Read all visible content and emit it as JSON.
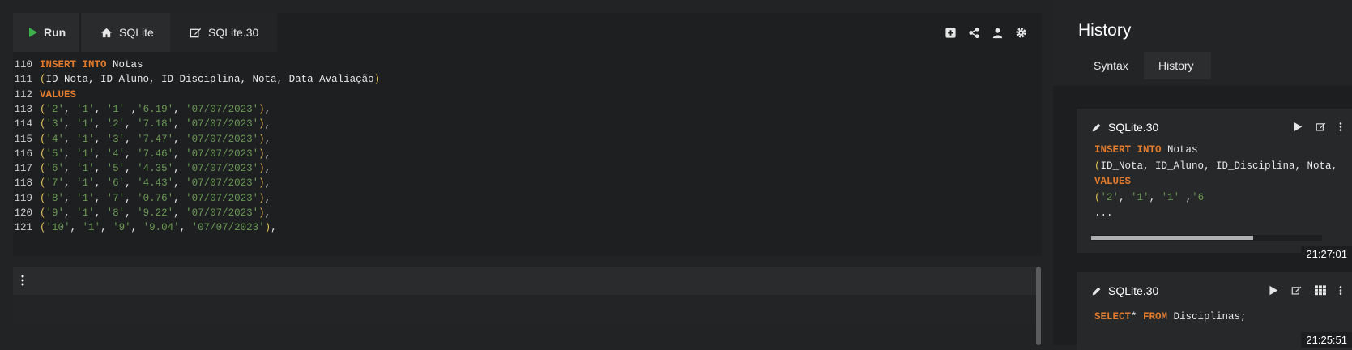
{
  "toolbar": {
    "run_label": "Run",
    "tabs": [
      {
        "label": "SQLite",
        "icon": "home-icon"
      },
      {
        "label": "SQLite.30",
        "icon": "edit-icon"
      }
    ],
    "icons": [
      "add-icon",
      "share-icon",
      "user-icon",
      "gear-icon"
    ]
  },
  "editor": {
    "lines": [
      {
        "n": "110",
        "tokens": [
          [
            "kw",
            "INSERT"
          ],
          [
            "code",
            " "
          ],
          [
            "kw",
            "INTO"
          ],
          [
            "code",
            " Notas"
          ]
        ]
      },
      {
        "n": "111",
        "tokens": [
          [
            "pun",
            "("
          ],
          [
            "code",
            "ID_Nota, ID_Aluno, ID_Disciplina, Nota, Data_Avaliação"
          ],
          [
            "pun",
            ")"
          ]
        ]
      },
      {
        "n": "112",
        "tokens": [
          [
            "kw",
            "VALUES"
          ]
        ]
      },
      {
        "n": "113",
        "tokens": [
          [
            "pun",
            "("
          ],
          [
            "str",
            "'2'"
          ],
          [
            "code",
            ", "
          ],
          [
            "str",
            "'1'"
          ],
          [
            "code",
            ", "
          ],
          [
            "str",
            "'1'"
          ],
          [
            "code",
            " ,"
          ],
          [
            "str",
            "'6.19'"
          ],
          [
            "code",
            ", "
          ],
          [
            "str",
            "'07/07/2023'"
          ],
          [
            "pun",
            ")"
          ],
          [
            "code",
            ","
          ]
        ]
      },
      {
        "n": "114",
        "tokens": [
          [
            "pun",
            "("
          ],
          [
            "str",
            "'3'"
          ],
          [
            "code",
            ", "
          ],
          [
            "str",
            "'1'"
          ],
          [
            "code",
            ", "
          ],
          [
            "str",
            "'2'"
          ],
          [
            "code",
            ", "
          ],
          [
            "str",
            "'7.18'"
          ],
          [
            "code",
            ", "
          ],
          [
            "str",
            "'07/07/2023'"
          ],
          [
            "pun",
            ")"
          ],
          [
            "code",
            ","
          ]
        ]
      },
      {
        "n": "115",
        "tokens": [
          [
            "pun",
            "("
          ],
          [
            "str",
            "'4'"
          ],
          [
            "code",
            ", "
          ],
          [
            "str",
            "'1'"
          ],
          [
            "code",
            ", "
          ],
          [
            "str",
            "'3'"
          ],
          [
            "code",
            ", "
          ],
          [
            "str",
            "'7.47'"
          ],
          [
            "code",
            ", "
          ],
          [
            "str",
            "'07/07/2023'"
          ],
          [
            "pun",
            ")"
          ],
          [
            "code",
            ","
          ]
        ]
      },
      {
        "n": "116",
        "tokens": [
          [
            "pun",
            "("
          ],
          [
            "str",
            "'5'"
          ],
          [
            "code",
            ", "
          ],
          [
            "str",
            "'1'"
          ],
          [
            "code",
            ", "
          ],
          [
            "str",
            "'4'"
          ],
          [
            "code",
            ", "
          ],
          [
            "str",
            "'7.46'"
          ],
          [
            "code",
            ", "
          ],
          [
            "str",
            "'07/07/2023'"
          ],
          [
            "pun",
            ")"
          ],
          [
            "code",
            ","
          ]
        ]
      },
      {
        "n": "117",
        "tokens": [
          [
            "pun",
            "("
          ],
          [
            "str",
            "'6'"
          ],
          [
            "code",
            ", "
          ],
          [
            "str",
            "'1'"
          ],
          [
            "code",
            ", "
          ],
          [
            "str",
            "'5'"
          ],
          [
            "code",
            ", "
          ],
          [
            "str",
            "'4.35'"
          ],
          [
            "code",
            ", "
          ],
          [
            "str",
            "'07/07/2023'"
          ],
          [
            "pun",
            ")"
          ],
          [
            "code",
            ","
          ]
        ]
      },
      {
        "n": "118",
        "tokens": [
          [
            "pun",
            "("
          ],
          [
            "str",
            "'7'"
          ],
          [
            "code",
            ", "
          ],
          [
            "str",
            "'1'"
          ],
          [
            "code",
            ", "
          ],
          [
            "str",
            "'6'"
          ],
          [
            "code",
            ", "
          ],
          [
            "str",
            "'4.43'"
          ],
          [
            "code",
            ", "
          ],
          [
            "str",
            "'07/07/2023'"
          ],
          [
            "pun",
            ")"
          ],
          [
            "code",
            ","
          ]
        ]
      },
      {
        "n": "119",
        "tokens": [
          [
            "pun",
            "("
          ],
          [
            "str",
            "'8'"
          ],
          [
            "code",
            ", "
          ],
          [
            "str",
            "'1'"
          ],
          [
            "code",
            ", "
          ],
          [
            "str",
            "'7'"
          ],
          [
            "code",
            ", "
          ],
          [
            "str",
            "'0.76'"
          ],
          [
            "code",
            ", "
          ],
          [
            "str",
            "'07/07/2023'"
          ],
          [
            "pun",
            ")"
          ],
          [
            "code",
            ","
          ]
        ]
      },
      {
        "n": "120",
        "tokens": [
          [
            "pun",
            "("
          ],
          [
            "str",
            "'9'"
          ],
          [
            "code",
            ", "
          ],
          [
            "str",
            "'1'"
          ],
          [
            "code",
            ", "
          ],
          [
            "str",
            "'8'"
          ],
          [
            "code",
            ", "
          ],
          [
            "str",
            "'9.22'"
          ],
          [
            "code",
            ", "
          ],
          [
            "str",
            "'07/07/2023'"
          ],
          [
            "pun",
            ")"
          ],
          [
            "code",
            ","
          ]
        ]
      },
      {
        "n": "121",
        "tokens": [
          [
            "pun",
            "("
          ],
          [
            "str",
            "'10'"
          ],
          [
            "code",
            ", "
          ],
          [
            "str",
            "'1'"
          ],
          [
            "code",
            ", "
          ],
          [
            "str",
            "'9'"
          ],
          [
            "code",
            ", "
          ],
          [
            "str",
            "'9.04'"
          ],
          [
            "code",
            ", "
          ],
          [
            "str",
            "'07/07/2023'"
          ],
          [
            "pun",
            ")"
          ],
          [
            "code",
            ","
          ]
        ]
      }
    ]
  },
  "history_panel": {
    "title": "History",
    "tabs": [
      "Syntax",
      "History"
    ],
    "active_tab": "History",
    "entries": [
      {
        "name": "SQLite.30",
        "time": "21:27:01",
        "lines": [
          [
            [
              "kw",
              "INSERT"
            ],
            [
              "code",
              " "
            ],
            [
              "kw",
              "INTO"
            ],
            [
              "code",
              " Notas"
            ]
          ],
          [
            [
              "pun",
              "("
            ],
            [
              "code",
              "ID_Nota, ID_Aluno, ID_Disciplina, Nota, "
            ]
          ],
          [
            [
              "kw",
              "VALUES"
            ]
          ],
          [
            [
              "pun",
              "("
            ],
            [
              "str",
              "'2'"
            ],
            [
              "code",
              ", "
            ],
            [
              "str",
              "'1'"
            ],
            [
              "code",
              ", "
            ],
            [
              "str",
              "'1'"
            ],
            [
              "code",
              " ,"
            ],
            [
              "str",
              "'6"
            ]
          ],
          [
            [
              "code",
              "..."
            ]
          ]
        ]
      },
      {
        "name": "SQLite.30",
        "time": "21:25:51",
        "lines": [
          [
            [
              "kw",
              "SELECT"
            ],
            [
              "code",
              "* "
            ],
            [
              "kw",
              "FROM"
            ],
            [
              "code",
              " Disciplinas;"
            ]
          ]
        ]
      }
    ]
  },
  "colors": {
    "keyword": "#e07a2c",
    "string": "#6a9955",
    "paren": "#e0c05a",
    "run_green": "#3fae4c"
  }
}
